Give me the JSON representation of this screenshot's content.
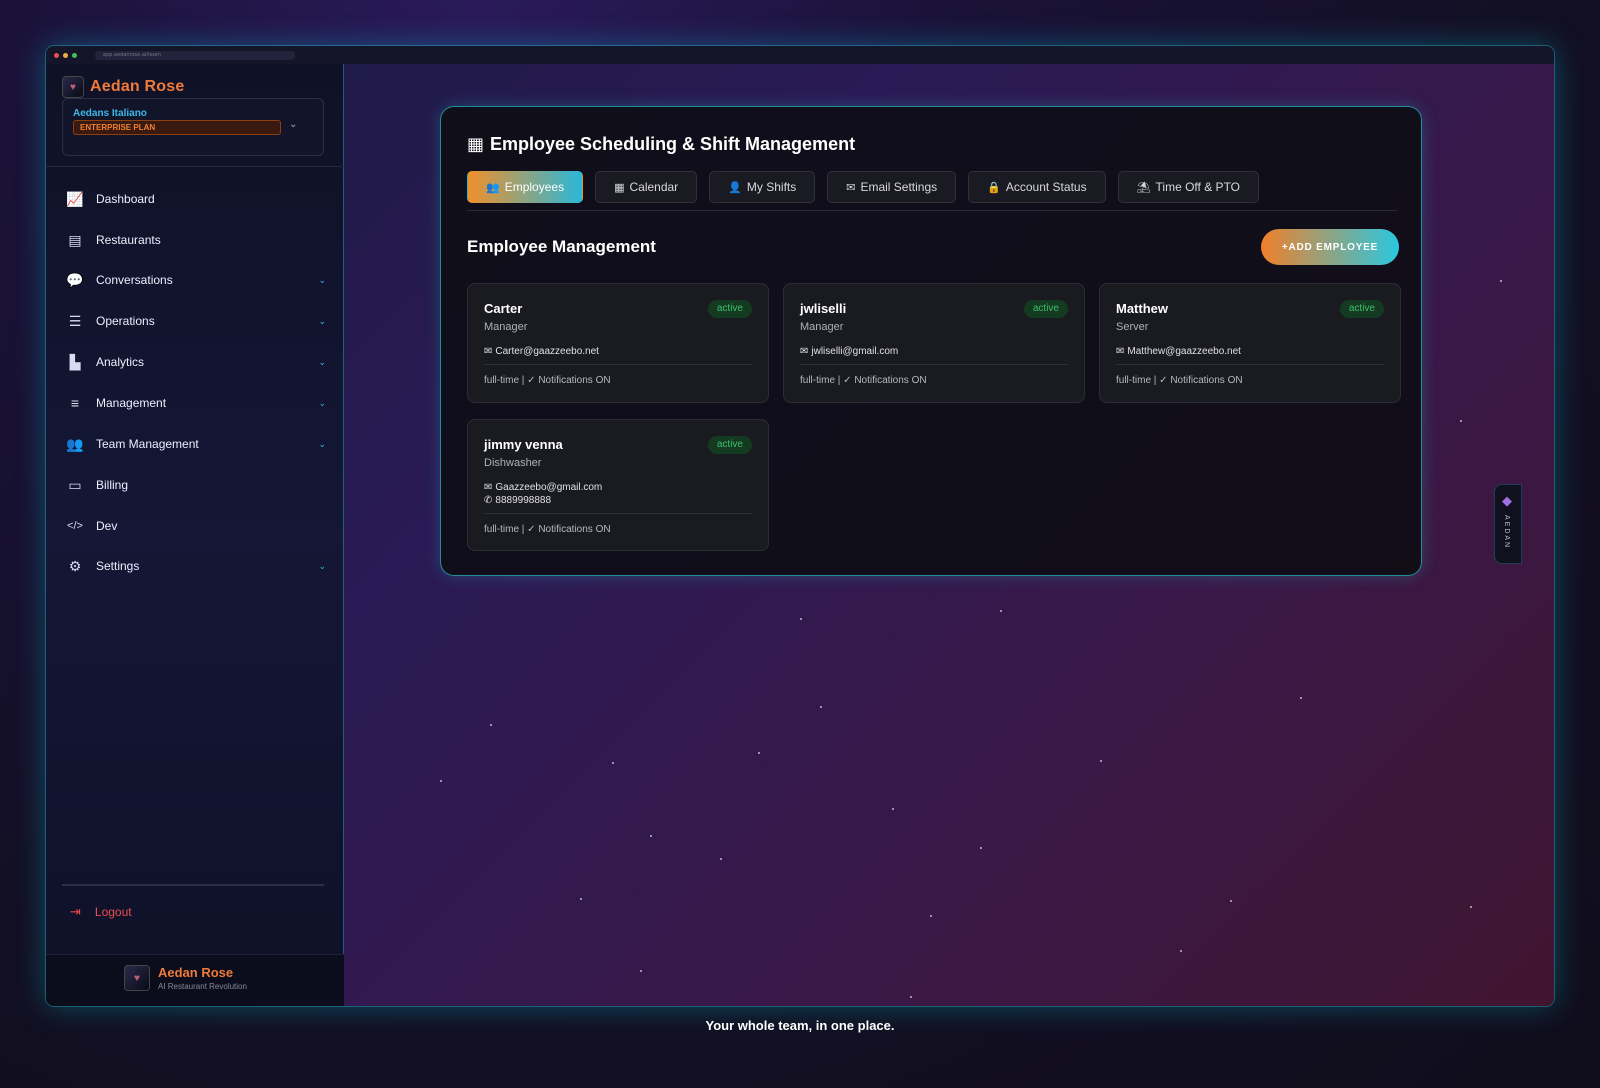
{
  "browser": {
    "url": "app.aedanrose.ai/team"
  },
  "brand": {
    "name": "Aedan Rose",
    "logo_icon": "logo-icon"
  },
  "org": {
    "name": "Aedans Italiano",
    "plan": "ENTERPRISE PLAN"
  },
  "nav": [
    {
      "label": "Dashboard",
      "icon": "chart-line-icon",
      "expandable": false
    },
    {
      "label": "Restaurants",
      "icon": "store-icon",
      "expandable": false
    },
    {
      "label": "Conversations",
      "icon": "comments-icon",
      "expandable": true
    },
    {
      "label": "Operations",
      "icon": "list-check-icon",
      "expandable": true
    },
    {
      "label": "Analytics",
      "icon": "chart-bar-icon",
      "expandable": true
    },
    {
      "label": "Management",
      "icon": "database-icon",
      "expandable": true
    },
    {
      "label": "Team Management",
      "icon": "users-icon",
      "expandable": true
    },
    {
      "label": "Billing",
      "icon": "credit-card-icon",
      "expandable": false
    },
    {
      "label": "Dev",
      "icon": "code-icon",
      "expandable": false
    },
    {
      "label": "Settings",
      "icon": "gear-icon",
      "expandable": true
    }
  ],
  "logout": {
    "label": "Logout"
  },
  "footer": {
    "name": "Aedan Rose",
    "tagline": "AI Restaurant Revolution"
  },
  "panel": {
    "title": "Employee Scheduling & Shift Management",
    "tabs": [
      {
        "label": "Employees",
        "active": true
      },
      {
        "label": "Calendar",
        "active": false
      },
      {
        "label": "My Shifts",
        "active": false
      },
      {
        "label": "Email Settings",
        "active": false
      },
      {
        "label": "Account Status",
        "active": false
      },
      {
        "label": "Time Off & PTO",
        "active": false
      }
    ],
    "section_title": "Employee Management",
    "add_button": "ADD EMPLOYEE"
  },
  "employees": [
    {
      "name": "Carter",
      "role": "Manager",
      "status": "active",
      "email": "Carter@gaazzeebo.net",
      "phone": "",
      "meta": "full-time | ✓ Notifications ON"
    },
    {
      "name": "jwliselli",
      "role": "Manager",
      "status": "active",
      "email": "jwliselli@gmail.com",
      "phone": "",
      "meta": "full-time | ✓ Notifications ON"
    },
    {
      "name": "Matthew",
      "role": "Server",
      "status": "active",
      "email": "Matthew@gaazzeebo.net",
      "phone": "",
      "meta": "full-time | ✓ Notifications ON"
    },
    {
      "name": "jimmy venna",
      "role": "Dishwasher",
      "status": "active",
      "email": "Gaazzeebo@gmail.com",
      "phone": "8889998888",
      "meta": "full-time | ✓ Notifications ON"
    }
  ],
  "side_tab": {
    "label": "AEDAN"
  },
  "caption": "Your whole team, in one place.",
  "colors": {
    "accent_orange": "#f0802a",
    "accent_cyan": "#2ac8e0",
    "active_green": "#3ac06a"
  }
}
